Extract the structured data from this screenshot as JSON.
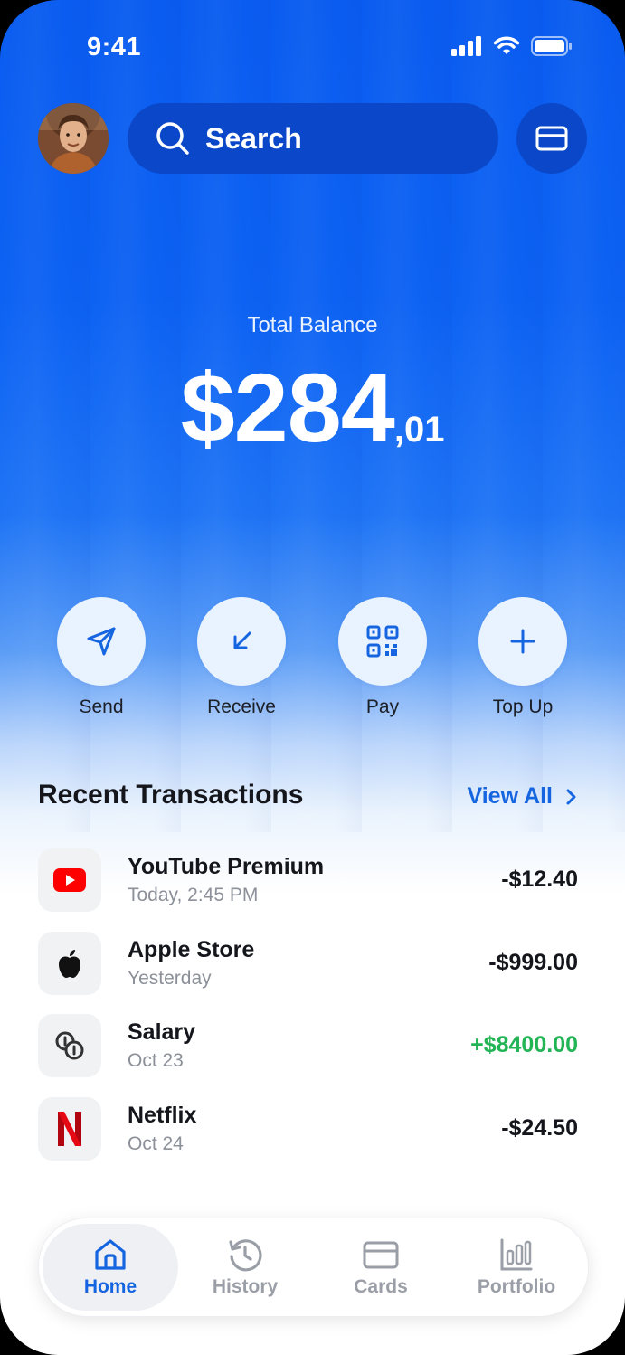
{
  "status_bar": {
    "time": "9:41"
  },
  "header": {
    "search_placeholder": "Search"
  },
  "balance": {
    "label": "Total Balance",
    "main": "$284",
    "cents": ",01"
  },
  "actions": [
    {
      "label": "Send",
      "icon": "send-icon"
    },
    {
      "label": "Receive",
      "icon": "receive-arrow-icon"
    },
    {
      "label": "Pay",
      "icon": "qr-code-icon"
    },
    {
      "label": "Top Up",
      "icon": "plus-icon"
    }
  ],
  "transactions_section": {
    "title": "Recent Transactions",
    "view_all": "View All"
  },
  "transactions": [
    {
      "name": "YouTube Premium",
      "sub": "Today, 2:45 PM",
      "amount": "-$12.40",
      "icon": "youtube-icon"
    },
    {
      "name": "Apple Store",
      "sub": "Yesterday",
      "amount": "-$999.00",
      "icon": "apple-icon"
    },
    {
      "name": "Salary",
      "sub": "Oct 23",
      "amount": "+$8400.00",
      "icon": "coins-icon"
    },
    {
      "name": "Netflix",
      "sub": "Oct 24",
      "amount": "-$24.50",
      "icon": "netflix-icon"
    }
  ],
  "nav": [
    {
      "label": "Home",
      "icon": "home-icon",
      "active": true
    },
    {
      "label": "History",
      "icon": "history-icon",
      "active": false
    },
    {
      "label": "Cards",
      "icon": "card-icon",
      "active": false
    },
    {
      "label": "Portfolio",
      "icon": "bar-chart-icon",
      "active": false
    }
  ],
  "colors": {
    "brand_blue": "#0a5cf0",
    "accent": "#1565e0",
    "positive": "#22b455",
    "youtube_red": "#ff0000",
    "netflix_red": "#e50914"
  }
}
